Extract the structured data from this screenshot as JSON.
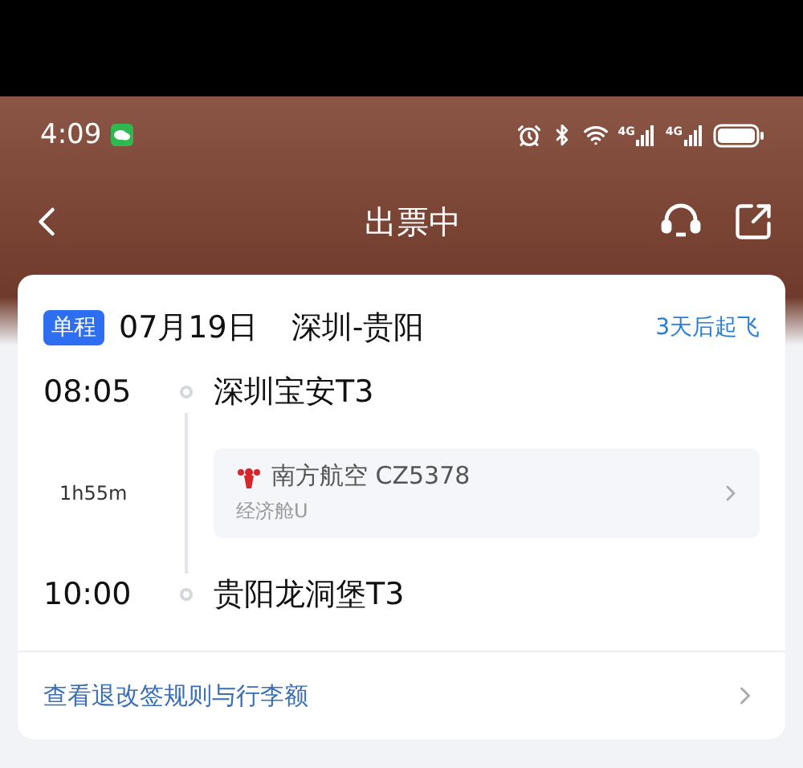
{
  "status_bar": {
    "time": "4:09",
    "signals": [
      {
        "label": "4G"
      },
      {
        "label": "4G"
      }
    ]
  },
  "nav": {
    "title": "出票中"
  },
  "trip": {
    "badge": "单程",
    "date": "07月19日",
    "route": "深圳-贵阳",
    "countdown": "3天后起飞",
    "departure": {
      "time": "08:05",
      "airport": "深圳宝安T3"
    },
    "duration": "1h55m",
    "flight": {
      "airline": "南方航空 CZ5378",
      "cabin": "经济舱U"
    },
    "arrival": {
      "time": "10:00",
      "airport": "贵阳龙洞堡T3"
    },
    "rules_link": "查看退改签规则与行李额"
  }
}
